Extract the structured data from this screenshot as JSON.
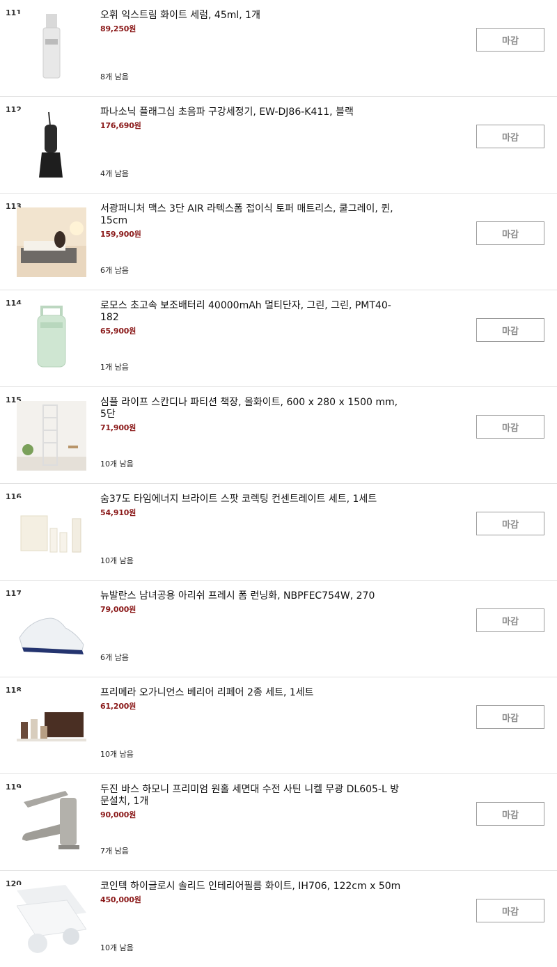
{
  "items": [
    {
      "num": "111",
      "title": "오휘 익스트림 화이트 세럼, 45ml, 1개",
      "price": "89,250원",
      "stock": "8개 남음",
      "button": "마감",
      "image": "serum-bottle-image"
    },
    {
      "num": "112",
      "title": "파나소닉 플래그십 초음파 구강세정기, EW-DJ86-K411, 블랙",
      "price": "176,690원",
      "stock": "4개 남음",
      "button": "마감",
      "image": "oral-irrigator-image"
    },
    {
      "num": "113",
      "title": "서광퍼니처 맥스 3단 AIR 라텍스폼 접이식 토퍼 매트리스, 쿨그레이, 퀸, 15cm",
      "price": "159,900원",
      "stock": "6개 남음",
      "button": "마감",
      "image": "mattress-room-image"
    },
    {
      "num": "114",
      "title": "로모스 초고속 보조배터리 40000mAh 멀티단자, 그린, 그린, PMT40-182",
      "price": "65,900원",
      "stock": "1개 남음",
      "button": "마감",
      "image": "power-bank-image"
    },
    {
      "num": "115",
      "title": "심플 라이프 스칸디나 파티션 책장, 올화이트, 600 x 280 x 1500 mm, 5단",
      "price": "71,900원",
      "stock": "10개 남음",
      "button": "마감",
      "image": "bookshelf-image"
    },
    {
      "num": "116",
      "title": "숨37도 타임에너지 브라이트 스팟 코렉팅 컨센트레이트 세트, 1세트",
      "price": "54,910원",
      "stock": "10개 남음",
      "button": "마감",
      "image": "cosmetic-set-image"
    },
    {
      "num": "117",
      "title": "뉴발란스 남녀공용 아리쉬 프레시 폼 런닝화, NBPFEC754W, 270",
      "price": "79,000원",
      "stock": "6개 남음",
      "button": "마감",
      "image": "running-shoe-image"
    },
    {
      "num": "118",
      "title": "프리메라 오가니언스 베리어 리페어 2종 세트, 1세트",
      "price": "61,200원",
      "stock": "10개 남음",
      "button": "마감",
      "image": "skincare-set-image"
    },
    {
      "num": "119",
      "title": "두진 바스 하모니 프리미엄 원홀 세면대 수전 사틴 니켈 무광 DL605-L 방문설치, 1개",
      "price": "90,000원",
      "stock": "7개 남음",
      "button": "마감",
      "image": "faucet-image"
    },
    {
      "num": "120",
      "title": "코인텍 하이글로시 솔리드 인테리어필름 화이트, IH706, 122cm x 50m",
      "price": "450,000원",
      "stock": "10개 남음",
      "button": "마감",
      "image": "film-roll-image"
    }
  ]
}
